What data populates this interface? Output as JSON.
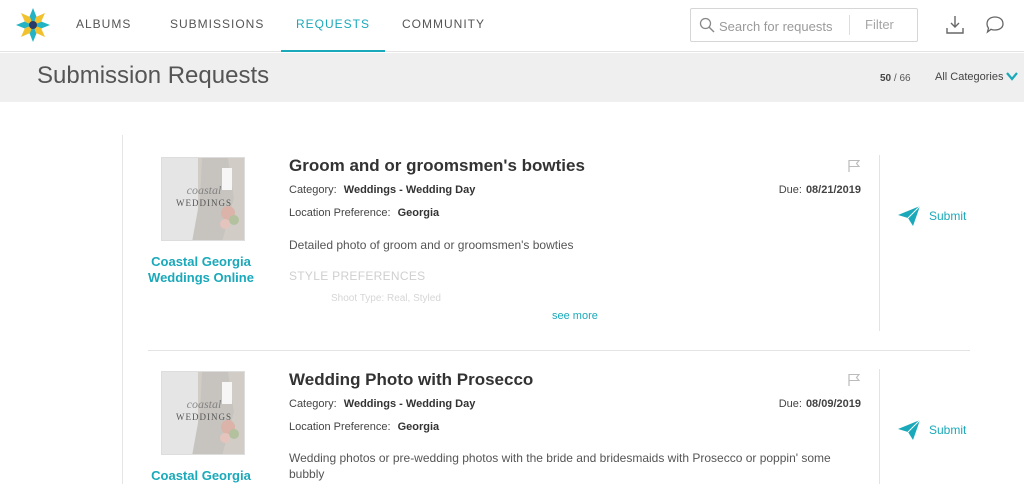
{
  "nav": {
    "items": [
      {
        "label": "ALBUMS"
      },
      {
        "label": "SUBMISSIONS"
      },
      {
        "label": "REQUESTS"
      },
      {
        "label": "COMMUNITY"
      }
    ],
    "search_placeholder": "Search for requests",
    "filter_label": "Filter"
  },
  "header": {
    "title": "Submission Requests",
    "count_current": "50",
    "count_separator": "/",
    "count_total": "66",
    "category_select": "All Categories"
  },
  "requests": [
    {
      "owner": "Coastal Georgia Weddings Online",
      "thumb_text": "WEDDINGS",
      "title": "Groom and or groomsmen's bowties",
      "category_label": "Category:",
      "category": "Weddings - Wedding Day",
      "location_label": "Location Preference:",
      "location": "Georgia",
      "due_label": "Due:",
      "due": "08/21/2019",
      "description": "Detailed photo of groom and or groomsmen's bowties",
      "style_heading": "STYLE PREFERENCES",
      "shoot_type": "Shoot Type:  Real, Styled",
      "see_more": "see more",
      "submit": "Submit"
    },
    {
      "owner": "Coastal Georgia",
      "thumb_text": "WEDDINGS",
      "title": "Wedding Photo with Prosecco",
      "category_label": "Category:",
      "category": "Weddings - Wedding Day",
      "location_label": "Location Preference:",
      "location": "Georgia",
      "due_label": "Due:",
      "due": "08/09/2019",
      "description": "Wedding photos or pre-wedding photos with the bride and bridesmaids with Prosecco or poppin' some bubbly",
      "submit": "Submit"
    }
  ],
  "colors": {
    "accent": "#1aa9ba",
    "logo_teal": "#23b3c4",
    "logo_yellow": "#f2c12e",
    "logo_navy": "#2b3a67"
  },
  "icons": [
    "logo-icon",
    "search-icon",
    "download-icon",
    "chat-icon",
    "chevron-down-icon",
    "flag-icon",
    "paper-plane-icon"
  ]
}
